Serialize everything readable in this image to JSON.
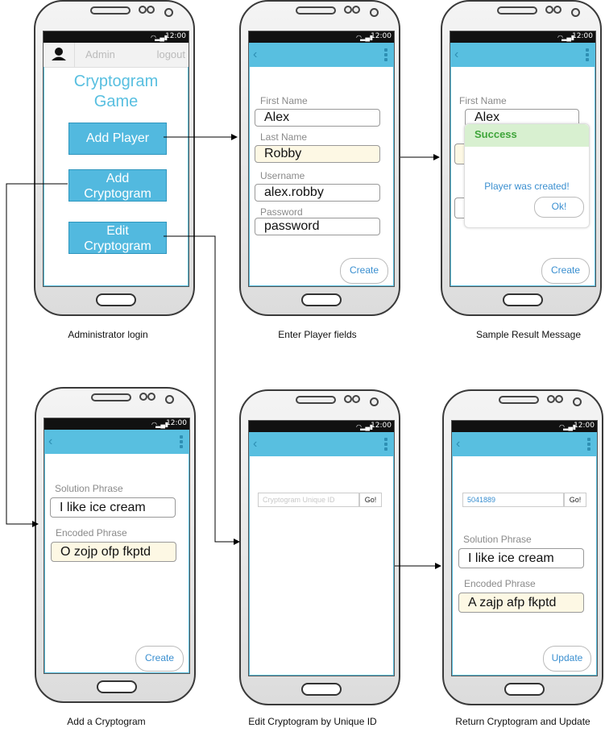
{
  "status_time": "12:00",
  "screens": {
    "login": {
      "user": "Admin",
      "logout": "logout",
      "title_line1": "Cryptogram",
      "title_line2": "Game",
      "btn_add_player": "Add Player",
      "btn_add_crypto_1": "Add",
      "btn_add_crypto_2": "Cryptogram",
      "btn_edit_crypto_1": "Edit",
      "btn_edit_crypto_2": "Cryptogram",
      "caption": "Administrator login"
    },
    "player": {
      "first_name_label": "First Name",
      "first_name": "Alex",
      "last_name_label": "Last Name",
      "last_name": "Robby",
      "username_label": "Username",
      "username": "alex.robby",
      "password_label": "Password",
      "password": "password",
      "create": "Create",
      "caption": "Enter Player fields"
    },
    "result": {
      "first_name_label": "First Name",
      "first_name": "Alex",
      "dialog_title": "Success",
      "dialog_message": "Player was created!",
      "ok": "Ok!",
      "create": "Create",
      "caption": "Sample Result Message"
    },
    "add_crypto": {
      "solution_label": "Solution Phrase",
      "solution": "I like ice cream",
      "encoded_label": "Encoded Phrase",
      "encoded": "O zojp ofp fkptd",
      "create": "Create",
      "caption": "Add a Cryptogram"
    },
    "edit_crypto": {
      "id_placeholder": "Cryptogram Unique ID",
      "go": "Go!",
      "caption": "Edit Cryptogram by Unique ID"
    },
    "update_crypto": {
      "id_value": "5041889",
      "go": "Go!",
      "solution_label": "Solution Phrase",
      "solution": "I like ice cream",
      "encoded_label": "Encoded Phrase",
      "encoded": "A zajp afp fkptd",
      "update": "Update",
      "caption": "Return Cryptogram and Update"
    }
  },
  "colors": {
    "appbar": "#58bfe0",
    "button": "#52b9df",
    "success": "#3fa53a",
    "link": "#3a8fd0"
  }
}
